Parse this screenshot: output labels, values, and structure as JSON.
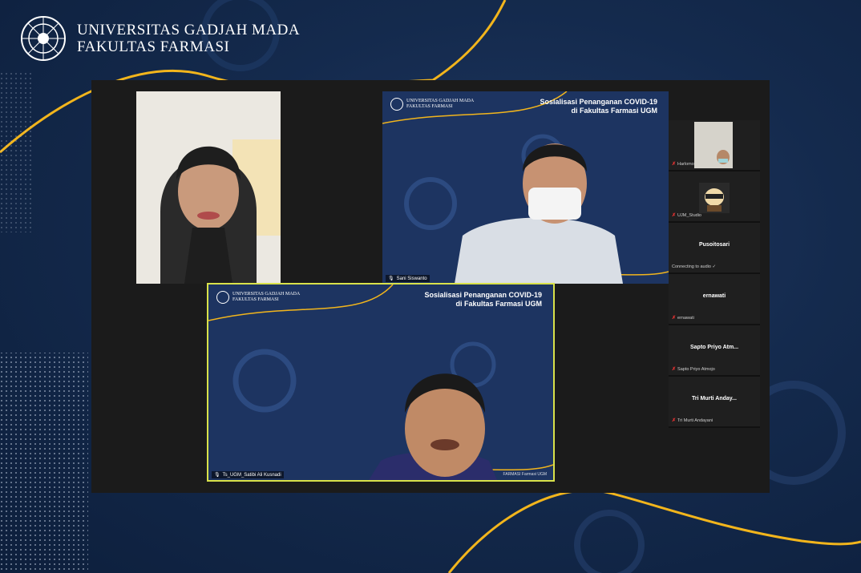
{
  "brand": {
    "line1": "UNIVERSITAS GADJAH MADA",
    "line2": "FAKULTAS FARMASI",
    "accent_color": "#f2b51c",
    "bg_color": "#142a4d"
  },
  "slide": {
    "title_line1": "Sosialisasi Penanganan COVID-19",
    "title_line2": "di Fakultas Farmasi UGM",
    "mini_brand_line1": "UNIVERSITAS GADJAH MADA",
    "mini_brand_line2": "FAKULTAS FARMASI",
    "watermark": "FARMASI Farmasi UGM"
  },
  "participants": {
    "presenter_b_name": "Sani Siswanto",
    "presenter_c_name": "Ts_UGM_Satibi Ali Kusnadi"
  },
  "sidebar": {
    "items": [
      {
        "label": "Harlomo"
      },
      {
        "label": "UJM_Studio"
      },
      {
        "center": "Pusoitosari",
        "label": "Connecting to audio ✓"
      },
      {
        "center": "ernawati",
        "label": "ernawati"
      },
      {
        "center": "Sapto Priyo Atm...",
        "label": "Sapto Priyo Atmojo"
      },
      {
        "center": "Tri Murti Anday...",
        "label": "Tri Murti Andayani"
      }
    ]
  }
}
